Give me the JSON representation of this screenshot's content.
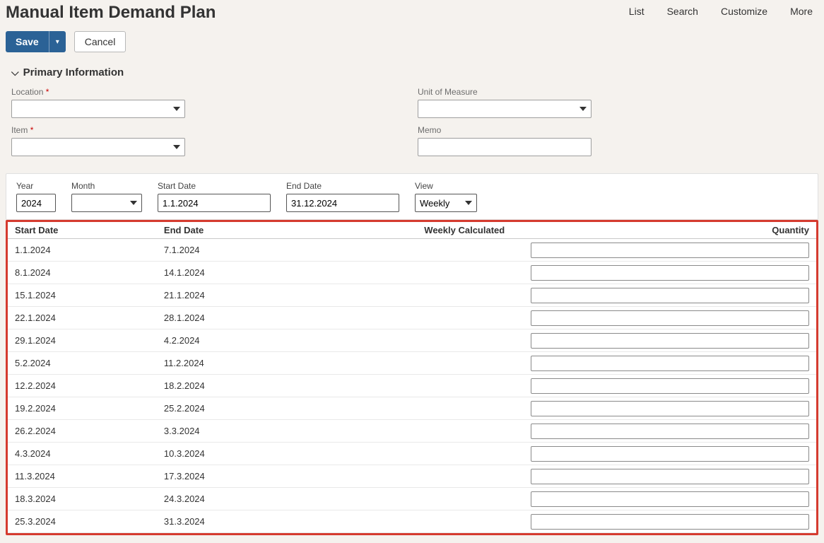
{
  "header": {
    "title": "Manual Item Demand Plan",
    "nav": [
      "List",
      "Search",
      "Customize",
      "More"
    ]
  },
  "buttons": {
    "save": "Save",
    "cancel": "Cancel"
  },
  "primary_section": {
    "title": "Primary Information",
    "labels": {
      "location": "Location",
      "item": "Item",
      "uom": "Unit of Measure",
      "memo": "Memo"
    },
    "values": {
      "location": "",
      "item": "",
      "uom": "",
      "memo": ""
    }
  },
  "filters": {
    "labels": {
      "year": "Year",
      "month": "Month",
      "start_date": "Start Date",
      "end_date": "End Date",
      "view": "View"
    },
    "values": {
      "year": "2024",
      "month": "",
      "start_date": "1.1.2024",
      "end_date": "31.12.2024",
      "view": "Weekly"
    }
  },
  "table": {
    "headers": {
      "start_date": "Start Date",
      "end_date": "End Date",
      "weekly": "Weekly Calculated",
      "quantity": "Quantity"
    },
    "rows": [
      {
        "start": "1.1.2024",
        "end": "7.1.2024",
        "weekly": "",
        "qty": ""
      },
      {
        "start": "8.1.2024",
        "end": "14.1.2024",
        "weekly": "",
        "qty": ""
      },
      {
        "start": "15.1.2024",
        "end": "21.1.2024",
        "weekly": "",
        "qty": ""
      },
      {
        "start": "22.1.2024",
        "end": "28.1.2024",
        "weekly": "",
        "qty": ""
      },
      {
        "start": "29.1.2024",
        "end": "4.2.2024",
        "weekly": "",
        "qty": ""
      },
      {
        "start": "5.2.2024",
        "end": "11.2.2024",
        "weekly": "",
        "qty": ""
      },
      {
        "start": "12.2.2024",
        "end": "18.2.2024",
        "weekly": "",
        "qty": ""
      },
      {
        "start": "19.2.2024",
        "end": "25.2.2024",
        "weekly": "",
        "qty": ""
      },
      {
        "start": "26.2.2024",
        "end": "3.3.2024",
        "weekly": "",
        "qty": ""
      },
      {
        "start": "4.3.2024",
        "end": "10.3.2024",
        "weekly": "",
        "qty": ""
      },
      {
        "start": "11.3.2024",
        "end": "17.3.2024",
        "weekly": "",
        "qty": ""
      },
      {
        "start": "18.3.2024",
        "end": "24.3.2024",
        "weekly": "",
        "qty": ""
      },
      {
        "start": "25.3.2024",
        "end": "31.3.2024",
        "weekly": "",
        "qty": ""
      }
    ]
  }
}
